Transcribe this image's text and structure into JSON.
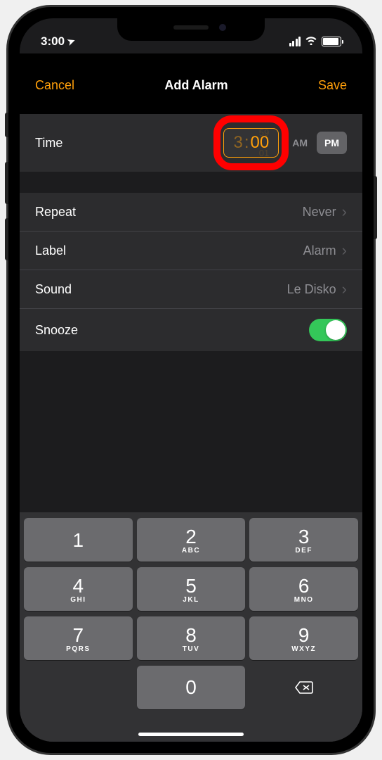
{
  "status": {
    "time": "3:00",
    "location_glyph": "➤"
  },
  "nav": {
    "cancel": "Cancel",
    "title": "Add Alarm",
    "save": "Save"
  },
  "time_row": {
    "label": "Time",
    "hour": "3",
    "minute": "00",
    "ghost_top": "59",
    "ghost_bottom": "01",
    "am": "AM",
    "pm": "PM",
    "selected_period": "PM"
  },
  "settings": {
    "repeat": {
      "label": "Repeat",
      "value": "Never"
    },
    "label_row": {
      "label": "Label",
      "value": "Alarm"
    },
    "sound": {
      "label": "Sound",
      "value": "Le Disko"
    },
    "snooze": {
      "label": "Snooze",
      "on": true
    }
  },
  "keypad": {
    "k1": {
      "num": "1",
      "sub": ""
    },
    "k2": {
      "num": "2",
      "sub": "ABC"
    },
    "k3": {
      "num": "3",
      "sub": "DEF"
    },
    "k4": {
      "num": "4",
      "sub": "GHI"
    },
    "k5": {
      "num": "5",
      "sub": "JKL"
    },
    "k6": {
      "num": "6",
      "sub": "MNO"
    },
    "k7": {
      "num": "7",
      "sub": "PQRS"
    },
    "k8": {
      "num": "8",
      "sub": "TUV"
    },
    "k9": {
      "num": "9",
      "sub": "WXYZ"
    },
    "k0": {
      "num": "0",
      "sub": ""
    }
  }
}
